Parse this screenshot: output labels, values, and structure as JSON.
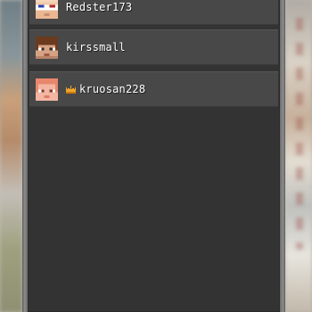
{
  "players": [
    {
      "name": "Redster173",
      "crown": false,
      "avatar": "redster-skin-face"
    },
    {
      "name": "kirssmall",
      "crown": false,
      "avatar": "kirssmall-skin-face"
    },
    {
      "name": "kruosan228",
      "crown": true,
      "avatar": "kruosan-skin-face"
    }
  ],
  "colors": {
    "panel": "#333333",
    "row": "#484848",
    "crown": "#f0a52a",
    "text": "#ffffff"
  }
}
